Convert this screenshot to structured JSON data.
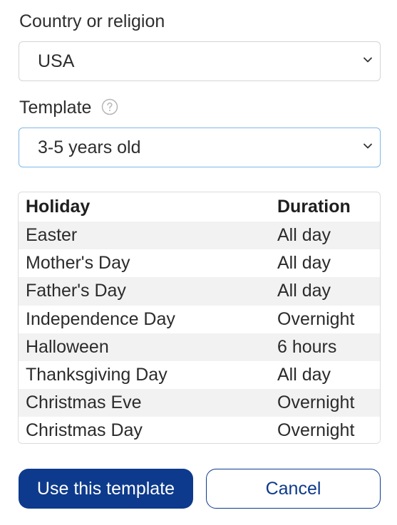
{
  "country": {
    "label": "Country or religion",
    "selected": "USA"
  },
  "template": {
    "label": "Template",
    "selected": "3-5 years old",
    "help_icon": "question-circle-icon"
  },
  "holidays_table": {
    "columns": [
      "Holiday",
      "Duration"
    ],
    "rows": [
      {
        "holiday": "Easter",
        "duration": "All day"
      },
      {
        "holiday": "Mother's Day",
        "duration": "All day"
      },
      {
        "holiday": "Father's Day",
        "duration": "All day"
      },
      {
        "holiday": "Independence Day",
        "duration": "Overnight"
      },
      {
        "holiday": "Halloween",
        "duration": "6 hours"
      },
      {
        "holiday": "Thanksgiving Day",
        "duration": "All day"
      },
      {
        "holiday": "Christmas Eve",
        "duration": "Overnight"
      },
      {
        "holiday": "Christmas Day",
        "duration": "Overnight"
      }
    ]
  },
  "actions": {
    "use_label": "Use this template",
    "cancel_label": "Cancel"
  },
  "colors": {
    "primary": "#0d3a8c",
    "focus_border": "#7fb8e6",
    "stripe": "#f2f2f2"
  }
}
